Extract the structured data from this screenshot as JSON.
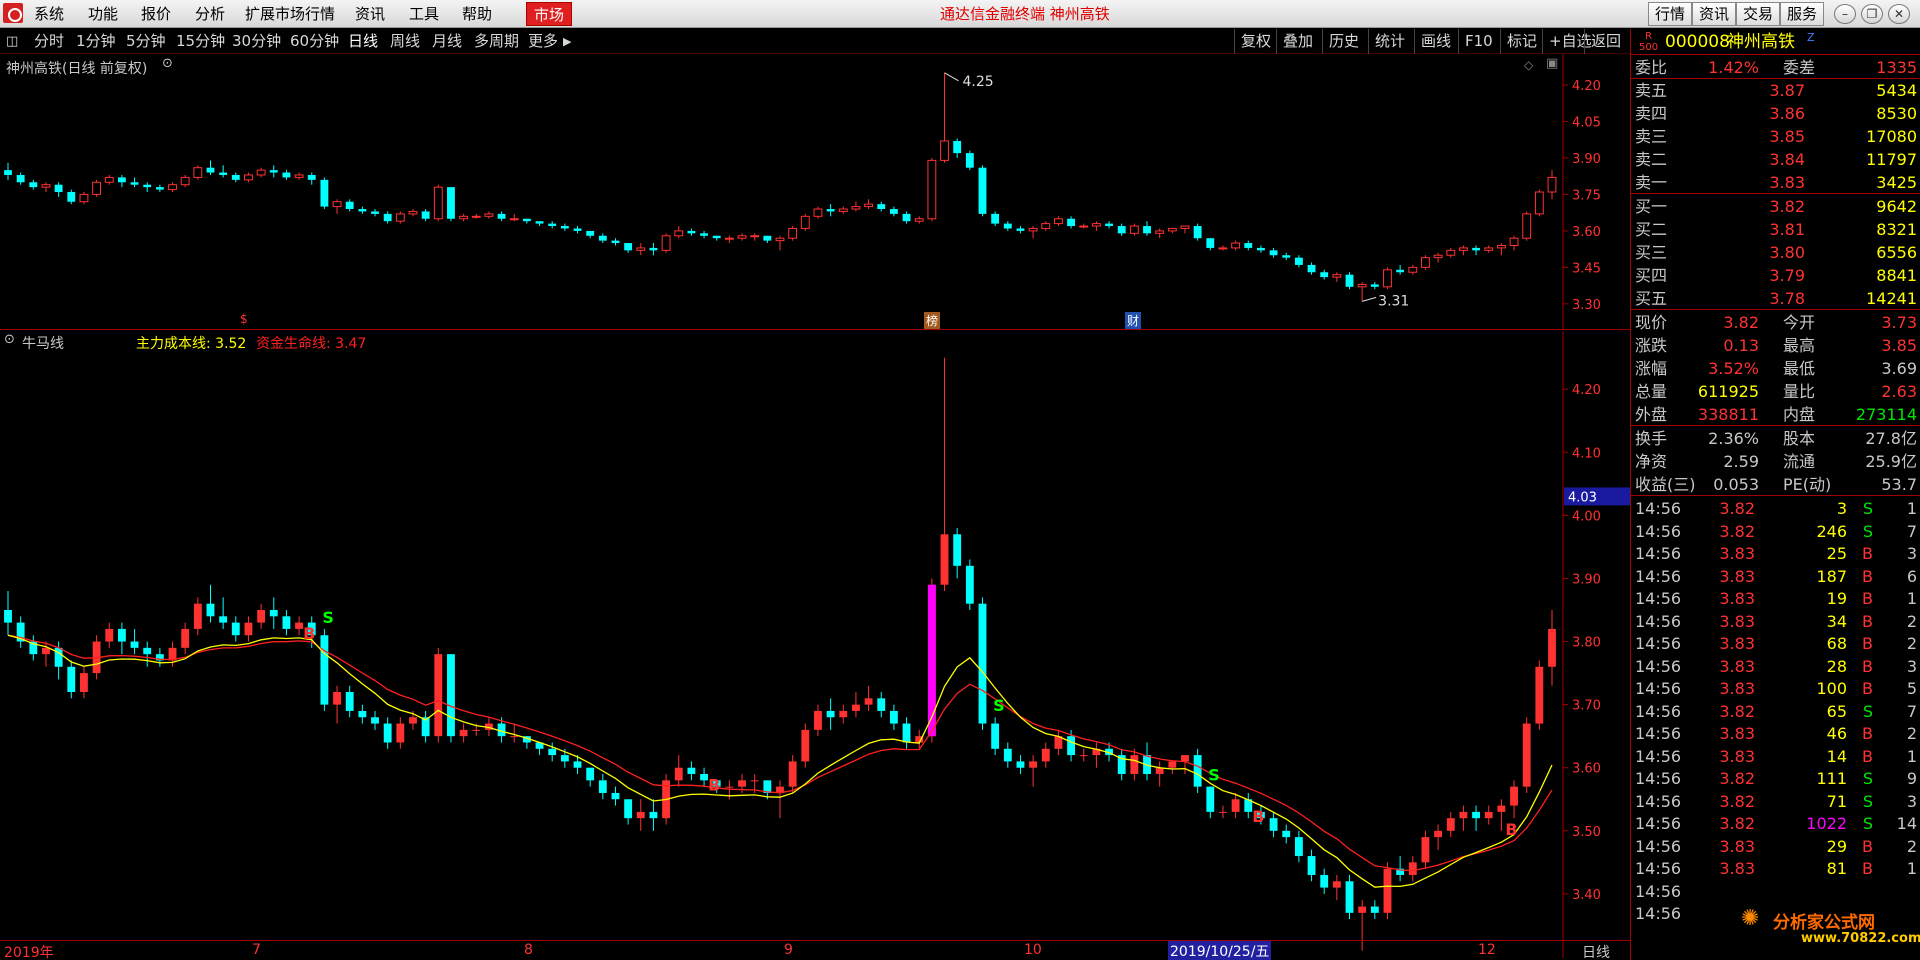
{
  "titlebar": {
    "menus": [
      "系统",
      "功能",
      "报价",
      "分析",
      "扩展市场行情",
      "资讯",
      "工具",
      "帮助"
    ],
    "market_tab": "市场",
    "window_title": "通达信金融终端  神州高铁",
    "buttons": [
      "行情",
      "资讯",
      "交易",
      "服务"
    ]
  },
  "period_toolbar": {
    "periods": [
      "分时",
      "1分钟",
      "5分钟",
      "15分钟",
      "30分钟",
      "60分钟",
      "日线",
      "周线",
      "月线",
      "多周期",
      "更多"
    ],
    "active": "日线",
    "right_tools": [
      "复权",
      "叠加",
      "历史",
      "统计",
      "画线",
      "F10",
      "标记",
      "+自选",
      "返回"
    ]
  },
  "main_chart": {
    "title": "神州高铁(日线 前复权)",
    "price_ticks": [
      "4.20",
      "4.05",
      "3.90",
      "3.75",
      "3.60",
      "3.45",
      "3.30"
    ],
    "high_label": "4.25",
    "low_label": "3.31",
    "markers": [
      {
        "text": "$",
        "color": "#ff3030",
        "bg": ""
      },
      {
        "text": "榜",
        "color": "#ffffff",
        "bg": "#a05a20"
      },
      {
        "text": "财",
        "color": "#ffffff",
        "bg": "#2050b0"
      }
    ]
  },
  "indicator_chart": {
    "name": "牛马线",
    "line1_label": "主力成本线: ",
    "line1_value": "3.52",
    "line2_label": "资金生命线: ",
    "line2_value": "3.47",
    "price_ticks": [
      "4.20",
      "4.10",
      "4.00",
      "3.90",
      "3.80",
      "3.70",
      "3.60",
      "3.50",
      "3.40"
    ],
    "current_price_tag": "4.03",
    "signal_b": "B",
    "signal_s": "S"
  },
  "date_axis": {
    "labels": [
      "2019年",
      "7",
      "8",
      "9",
      "10",
      "2019/10/25/五",
      "12"
    ],
    "period_label": "日线"
  },
  "quote_panel": {
    "code": "000008",
    "name": "神州高铁",
    "badge_top": "R",
    "badge_bottom": "500",
    "z_mark": "Z",
    "weibi_label": "委比",
    "weibi_value": "1.42%",
    "weicha_label": "委差",
    "weicha_value": "1335",
    "asks": [
      {
        "label": "卖五",
        "price": "3.87",
        "vol": "5434"
      },
      {
        "label": "卖四",
        "price": "3.86",
        "vol": "8530"
      },
      {
        "label": "卖三",
        "price": "3.85",
        "vol": "17080"
      },
      {
        "label": "卖二",
        "price": "3.84",
        "vol": "11797"
      },
      {
        "label": "卖一",
        "price": "3.83",
        "vol": "3425"
      }
    ],
    "bids": [
      {
        "label": "买一",
        "price": "3.82",
        "vol": "9642"
      },
      {
        "label": "买二",
        "price": "3.81",
        "vol": "8321"
      },
      {
        "label": "买三",
        "price": "3.80",
        "vol": "6556"
      },
      {
        "label": "买四",
        "price": "3.79",
        "vol": "8841"
      },
      {
        "label": "买五",
        "price": "3.78",
        "vol": "14241"
      }
    ],
    "stats": [
      {
        "l1": "现价",
        "v1": "3.82",
        "c1": "red",
        "l2": "今开",
        "v2": "3.73",
        "c2": "red"
      },
      {
        "l1": "涨跌",
        "v1": "0.13",
        "c1": "red",
        "l2": "最高",
        "v2": "3.85",
        "c2": "red"
      },
      {
        "l1": "涨幅",
        "v1": "3.52%",
        "c1": "red",
        "l2": "最低",
        "v2": "3.69",
        "c2": "white"
      },
      {
        "l1": "总量",
        "v1": "611925",
        "c1": "yellow",
        "l2": "量比",
        "v2": "2.63",
        "c2": "red"
      },
      {
        "l1": "外盘",
        "v1": "338811",
        "c1": "red",
        "l2": "内盘",
        "v2": "273114",
        "c2": "green"
      }
    ],
    "stats2": [
      {
        "l1": "换手",
        "v1": "2.36%",
        "l2": "股本",
        "v2": "27.8亿"
      },
      {
        "l1": "净资",
        "v1": "2.59",
        "l2": "流通",
        "v2": "25.9亿"
      },
      {
        "l1": "收益(三)",
        "v1": "0.053",
        "l2": "PE(动)",
        "v2": "53.7"
      }
    ],
    "ticks": [
      {
        "t": "14:56",
        "p": "3.82",
        "v": "3",
        "s": "S",
        "n": "1"
      },
      {
        "t": "14:56",
        "p": "3.82",
        "v": "246",
        "s": "S",
        "n": "7"
      },
      {
        "t": "14:56",
        "p": "3.83",
        "v": "25",
        "s": "B",
        "n": "3"
      },
      {
        "t": "14:56",
        "p": "3.83",
        "v": "187",
        "s": "B",
        "n": "6"
      },
      {
        "t": "14:56",
        "p": "3.83",
        "v": "19",
        "s": "B",
        "n": "1"
      },
      {
        "t": "14:56",
        "p": "3.83",
        "v": "34",
        "s": "B",
        "n": "2"
      },
      {
        "t": "14:56",
        "p": "3.83",
        "v": "68",
        "s": "B",
        "n": "2"
      },
      {
        "t": "14:56",
        "p": "3.83",
        "v": "28",
        "s": "B",
        "n": "3"
      },
      {
        "t": "14:56",
        "p": "3.83",
        "v": "100",
        "s": "B",
        "n": "5"
      },
      {
        "t": "14:56",
        "p": "3.82",
        "v": "65",
        "s": "S",
        "n": "7"
      },
      {
        "t": "14:56",
        "p": "3.83",
        "v": "46",
        "s": "B",
        "n": "2"
      },
      {
        "t": "14:56",
        "p": "3.83",
        "v": "14",
        "s": "B",
        "n": "1"
      },
      {
        "t": "14:56",
        "p": "3.82",
        "v": "111",
        "s": "S",
        "n": "9"
      },
      {
        "t": "14:56",
        "p": "3.82",
        "v": "71",
        "s": "S",
        "n": "3"
      },
      {
        "t": "14:56",
        "p": "3.82",
        "v": "1022",
        "s": "S",
        "n": "14"
      },
      {
        "t": "14:56",
        "p": "3.83",
        "v": "29",
        "s": "B",
        "n": "2"
      },
      {
        "t": "14:56",
        "p": "3.83",
        "v": "81",
        "s": "B",
        "n": "1"
      },
      {
        "t": "14:56",
        "p": "",
        "v": "",
        "s": "",
        "n": ""
      },
      {
        "t": "14:56",
        "p": "",
        "v": "",
        "s": "",
        "n": ""
      }
    ],
    "watermark_name": "分析家公式网",
    "watermark_url": "www.70822.com"
  },
  "colors": {
    "up": "#ff3232",
    "down": "#00ffff",
    "line_yellow": "#ffff00",
    "line_red": "#ff2020",
    "magenta": "#ff00ff",
    "border": "#a00000"
  },
  "chart_data": {
    "type": "candlestick",
    "ylim_main": [
      3.25,
      4.27
    ],
    "ylim_indicator": [
      3.3,
      4.27
    ],
    "series": [
      {
        "name": "主力成本线",
        "value": 3.52
      },
      {
        "name": "资金生命线",
        "value": 3.47
      }
    ],
    "ohlc": [
      [
        3.85,
        3.88,
        3.81,
        3.83
      ],
      [
        3.83,
        3.84,
        3.79,
        3.8
      ],
      [
        3.8,
        3.81,
        3.77,
        3.78
      ],
      [
        3.78,
        3.8,
        3.76,
        3.79
      ],
      [
        3.79,
        3.8,
        3.74,
        3.76
      ],
      [
        3.76,
        3.77,
        3.71,
        3.72
      ],
      [
        3.72,
        3.76,
        3.71,
        3.75
      ],
      [
        3.75,
        3.81,
        3.74,
        3.8
      ],
      [
        3.8,
        3.83,
        3.79,
        3.82
      ],
      [
        3.82,
        3.83,
        3.78,
        3.8
      ],
      [
        3.8,
        3.82,
        3.78,
        3.79
      ],
      [
        3.79,
        3.8,
        3.76,
        3.78
      ],
      [
        3.78,
        3.79,
        3.76,
        3.77
      ],
      [
        3.77,
        3.8,
        3.76,
        3.79
      ],
      [
        3.79,
        3.83,
        3.78,
        3.82
      ],
      [
        3.82,
        3.87,
        3.81,
        3.86
      ],
      [
        3.86,
        3.89,
        3.83,
        3.84
      ],
      [
        3.84,
        3.87,
        3.82,
        3.83
      ],
      [
        3.83,
        3.84,
        3.8,
        3.81
      ],
      [
        3.81,
        3.84,
        3.8,
        3.83
      ],
      [
        3.83,
        3.86,
        3.82,
        3.85
      ],
      [
        3.85,
        3.87,
        3.82,
        3.84
      ],
      [
        3.84,
        3.85,
        3.81,
        3.82
      ],
      [
        3.82,
        3.84,
        3.81,
        3.83
      ],
      [
        3.83,
        3.84,
        3.79,
        3.81
      ],
      [
        3.81,
        3.82,
        3.69,
        3.7
      ],
      [
        3.7,
        3.73,
        3.67,
        3.72
      ],
      [
        3.72,
        3.73,
        3.68,
        3.69
      ],
      [
        3.69,
        3.7,
        3.67,
        3.68
      ],
      [
        3.68,
        3.69,
        3.66,
        3.67
      ],
      [
        3.67,
        3.68,
        3.63,
        3.64
      ],
      [
        3.64,
        3.68,
        3.63,
        3.67
      ],
      [
        3.67,
        3.69,
        3.66,
        3.68
      ],
      [
        3.68,
        3.69,
        3.64,
        3.65
      ],
      [
        3.65,
        3.79,
        3.64,
        3.78
      ],
      [
        3.78,
        3.78,
        3.64,
        3.65
      ],
      [
        3.65,
        3.67,
        3.64,
        3.66
      ],
      [
        3.66,
        3.67,
        3.65,
        3.66
      ],
      [
        3.66,
        3.68,
        3.65,
        3.67
      ],
      [
        3.67,
        3.68,
        3.64,
        3.65
      ],
      [
        3.65,
        3.67,
        3.64,
        3.65
      ],
      [
        3.65,
        3.65,
        3.63,
        3.64
      ],
      [
        3.64,
        3.64,
        3.62,
        3.63
      ],
      [
        3.63,
        3.64,
        3.61,
        3.62
      ],
      [
        3.62,
        3.63,
        3.6,
        3.61
      ],
      [
        3.61,
        3.62,
        3.59,
        3.6
      ],
      [
        3.6,
        3.6,
        3.57,
        3.58
      ],
      [
        3.58,
        3.59,
        3.55,
        3.56
      ],
      [
        3.56,
        3.57,
        3.54,
        3.55
      ],
      [
        3.55,
        3.55,
        3.51,
        3.52
      ],
      [
        3.52,
        3.55,
        3.5,
        3.53
      ],
      [
        3.53,
        3.55,
        3.5,
        3.52
      ],
      [
        3.52,
        3.59,
        3.51,
        3.58
      ],
      [
        3.58,
        3.62,
        3.57,
        3.6
      ],
      [
        3.6,
        3.61,
        3.58,
        3.59
      ],
      [
        3.59,
        3.6,
        3.57,
        3.58
      ],
      [
        3.58,
        3.58,
        3.56,
        3.57
      ],
      [
        3.57,
        3.58,
        3.55,
        3.57
      ],
      [
        3.57,
        3.59,
        3.56,
        3.58
      ],
      [
        3.58,
        3.59,
        3.56,
        3.58
      ],
      [
        3.58,
        3.58,
        3.55,
        3.56
      ],
      [
        3.56,
        3.58,
        3.52,
        3.57
      ],
      [
        3.57,
        3.62,
        3.56,
        3.61
      ],
      [
        3.61,
        3.67,
        3.6,
        3.66
      ],
      [
        3.66,
        3.7,
        3.65,
        3.69
      ],
      [
        3.69,
        3.71,
        3.66,
        3.68
      ],
      [
        3.68,
        3.7,
        3.67,
        3.69
      ],
      [
        3.69,
        3.72,
        3.68,
        3.7
      ],
      [
        3.7,
        3.73,
        3.69,
        3.71
      ],
      [
        3.71,
        3.72,
        3.68,
        3.69
      ],
      [
        3.69,
        3.7,
        3.66,
        3.67
      ],
      [
        3.67,
        3.68,
        3.63,
        3.64
      ],
      [
        3.64,
        3.66,
        3.63,
        3.65
      ],
      [
        3.65,
        3.9,
        3.64,
        3.89
      ],
      [
        3.89,
        4.25,
        3.88,
        3.97
      ],
      [
        3.97,
        3.98,
        3.9,
        3.92
      ],
      [
        3.92,
        3.93,
        3.85,
        3.86
      ],
      [
        3.86,
        3.87,
        3.66,
        3.67
      ],
      [
        3.67,
        3.68,
        3.62,
        3.63
      ],
      [
        3.63,
        3.64,
        3.6,
        3.61
      ],
      [
        3.61,
        3.62,
        3.59,
        3.6
      ],
      [
        3.6,
        3.62,
        3.57,
        3.61
      ],
      [
        3.61,
        3.64,
        3.6,
        3.63
      ],
      [
        3.63,
        3.66,
        3.62,
        3.65
      ],
      [
        3.65,
        3.66,
        3.61,
        3.62
      ],
      [
        3.62,
        3.63,
        3.61,
        3.62
      ],
      [
        3.62,
        3.64,
        3.6,
        3.63
      ],
      [
        3.63,
        3.64,
        3.61,
        3.62
      ],
      [
        3.62,
        3.63,
        3.58,
        3.59
      ],
      [
        3.59,
        3.63,
        3.58,
        3.62
      ],
      [
        3.62,
        3.64,
        3.58,
        3.59
      ],
      [
        3.59,
        3.61,
        3.57,
        3.6
      ],
      [
        3.6,
        3.61,
        3.59,
        3.61
      ],
      [
        3.61,
        3.62,
        3.59,
        3.62
      ],
      [
        3.62,
        3.63,
        3.56,
        3.57
      ],
      [
        3.57,
        3.57,
        3.52,
        3.53
      ],
      [
        3.53,
        3.54,
        3.52,
        3.53
      ],
      [
        3.53,
        3.56,
        3.52,
        3.55
      ],
      [
        3.55,
        3.56,
        3.52,
        3.53
      ],
      [
        3.53,
        3.54,
        3.51,
        3.52
      ],
      [
        3.52,
        3.53,
        3.49,
        3.5
      ],
      [
        3.5,
        3.51,
        3.48,
        3.49
      ],
      [
        3.49,
        3.5,
        3.45,
        3.46
      ],
      [
        3.46,
        3.47,
        3.42,
        3.43
      ],
      [
        3.43,
        3.44,
        3.4,
        3.41
      ],
      [
        3.41,
        3.43,
        3.39,
        3.42
      ],
      [
        3.42,
        3.43,
        3.36,
        3.37
      ],
      [
        3.37,
        3.39,
        3.31,
        3.38
      ],
      [
        3.38,
        3.39,
        3.36,
        3.37
      ],
      [
        3.37,
        3.45,
        3.36,
        3.44
      ],
      [
        3.44,
        3.46,
        3.42,
        3.43
      ],
      [
        3.43,
        3.46,
        3.42,
        3.45
      ],
      [
        3.45,
        3.5,
        3.44,
        3.49
      ],
      [
        3.49,
        3.51,
        3.47,
        3.5
      ],
      [
        3.5,
        3.53,
        3.49,
        3.52
      ],
      [
        3.52,
        3.54,
        3.5,
        3.53
      ],
      [
        3.53,
        3.54,
        3.5,
        3.52
      ],
      [
        3.52,
        3.54,
        3.51,
        3.53
      ],
      [
        3.53,
        3.55,
        3.5,
        3.54
      ],
      [
        3.54,
        3.58,
        3.52,
        3.57
      ],
      [
        3.57,
        3.68,
        3.56,
        3.67
      ],
      [
        3.67,
        3.77,
        3.66,
        3.76
      ],
      [
        3.76,
        3.85,
        3.73,
        3.82
      ]
    ]
  }
}
